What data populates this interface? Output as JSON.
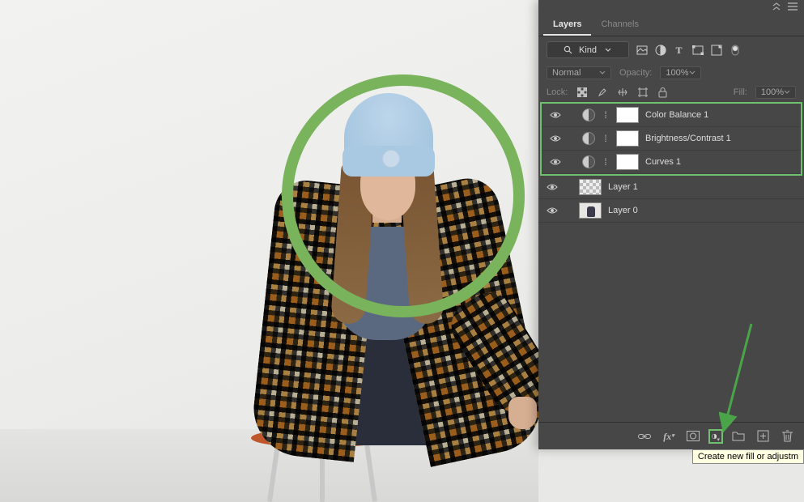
{
  "colors": {
    "annotation_green": "#6fc170",
    "panel_bg": "#474747"
  },
  "panel": {
    "tabs": [
      "Layers",
      "Channels"
    ],
    "active_tab": 0,
    "filter": {
      "label": "Kind"
    },
    "blend": {
      "mode": "Normal",
      "opacity_label": "Opacity:",
      "opacity_value": "100%"
    },
    "lock": {
      "label": "Lock:",
      "fill_label": "Fill:",
      "fill_value": "100%"
    },
    "layers": [
      {
        "type": "adjustment",
        "visible": true,
        "name": "Color Balance 1",
        "highlighted": true
      },
      {
        "type": "adjustment",
        "visible": true,
        "name": "Brightness/Contrast 1",
        "highlighted": true
      },
      {
        "type": "adjustment",
        "visible": true,
        "name": "Curves 1",
        "highlighted": true
      },
      {
        "type": "raster-transparent",
        "visible": true,
        "name": "Layer 1",
        "highlighted": false
      },
      {
        "type": "raster-image",
        "visible": true,
        "name": "Layer 0",
        "highlighted": false
      }
    ],
    "footer_tooltip": "Create new fill or adjustm"
  }
}
